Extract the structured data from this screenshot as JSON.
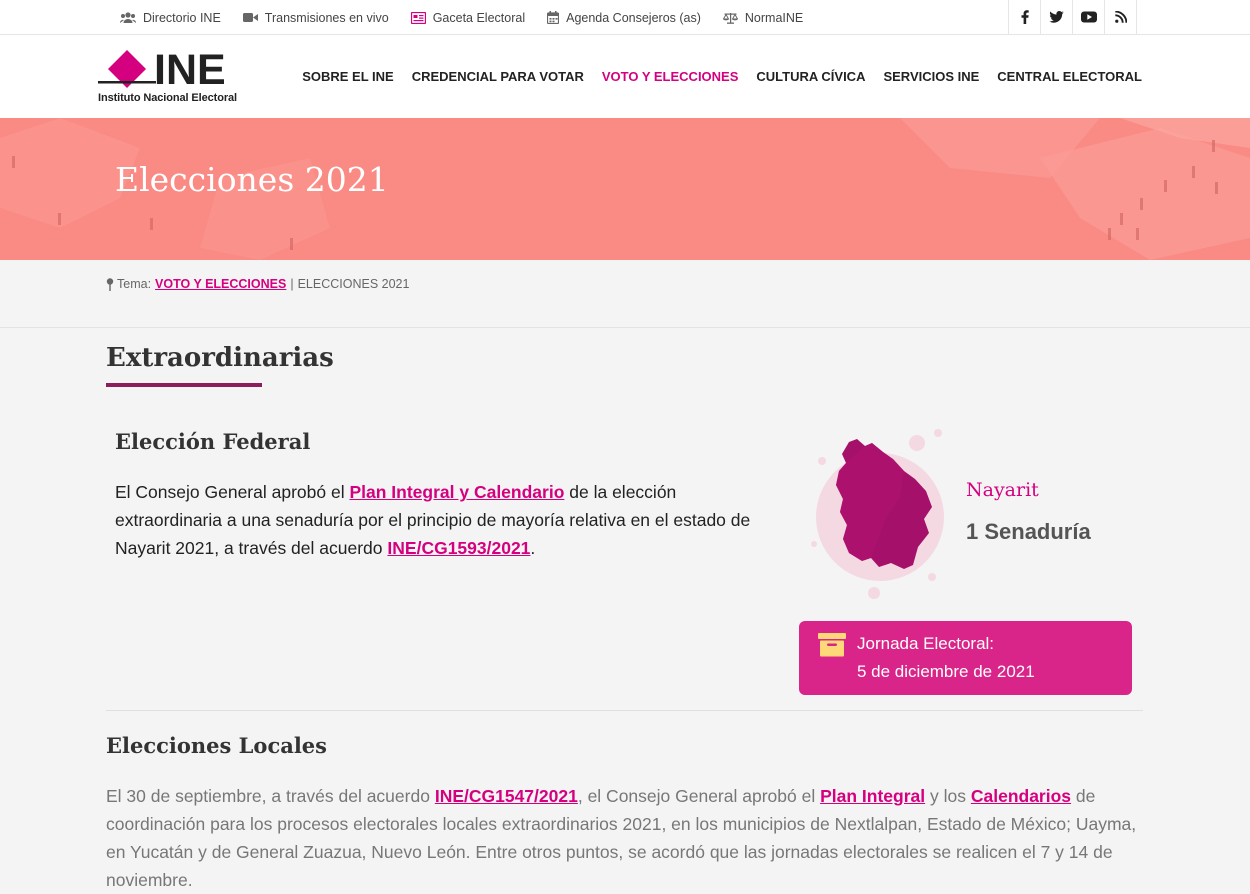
{
  "topbar": {
    "links": [
      {
        "label": "Directorio INE",
        "icon": "users-icon"
      },
      {
        "label": "Transmisiones en vivo",
        "icon": "video-icon"
      },
      {
        "label": "Gaceta Electoral",
        "icon": "newspaper-icon"
      },
      {
        "label": "Agenda Consejeros (as)",
        "icon": "calendar-icon"
      },
      {
        "label": "NormaINE",
        "icon": "scale-icon"
      }
    ],
    "social": [
      "facebook-icon",
      "twitter-icon",
      "youtube-icon",
      "rss-icon"
    ]
  },
  "header": {
    "logo_word": "INE",
    "logo_subtitle": "Instituto Nacional Electoral",
    "nav": [
      {
        "label": "SOBRE EL INE"
      },
      {
        "label": "CREDENCIAL PARA VOTAR"
      },
      {
        "label": "VOTO Y ELECCIONES",
        "active": true
      },
      {
        "label": "CULTURA CÍVICA"
      },
      {
        "label": "SERVICIOS INE"
      },
      {
        "label": "CENTRAL ELECTORAL"
      }
    ],
    "accent_color": "#d5007f"
  },
  "hero": {
    "title": "Elecciones 2021",
    "background": "#f98a84"
  },
  "breadcrumb": {
    "prefix": "Tema:",
    "link": "VOTO Y ELECCIONES",
    "separator": "|",
    "current": "ELECCIONES 2021"
  },
  "extraordinarias": {
    "title": "Extraordinarias",
    "federal": {
      "title": "Elección Federal",
      "text_1": "El Consejo General aprobó el",
      "link_1": "Plan Integral y Calendario",
      "text_2": "de la elección extraordinaria a una senaduría por el principio de mayoría relativa en el estado de Nayarit 2021, a través del acuerdo",
      "link_2": "INE/CG1593/2021",
      "text_3": "."
    },
    "state": {
      "name": "Nayarit",
      "seats": "1 Senaduría"
    },
    "jornada": {
      "label": "Jornada Electoral:",
      "date": "5 de diciembre de 2021"
    }
  },
  "locales": {
    "title": "Elecciones Locales",
    "text_1": "El 30 de septiembre, a través del acuerdo",
    "link_1": "INE/CG1547/2021",
    "text_2": ", el Consejo General aprobó el",
    "link_2": "Plan Integral",
    "text_3": "y los",
    "link_3": "Calendarios",
    "text_4": "de coordinación para los procesos electorales locales extraordinarios 2021, en los municipios de Nextlalpan, Estado de México; Uayma, en Yucatán y de General Zuazua, Nuevo León. Entre otros puntos, se acordó que las jornadas electorales se realicen el 7 y 14 de noviembre."
  }
}
